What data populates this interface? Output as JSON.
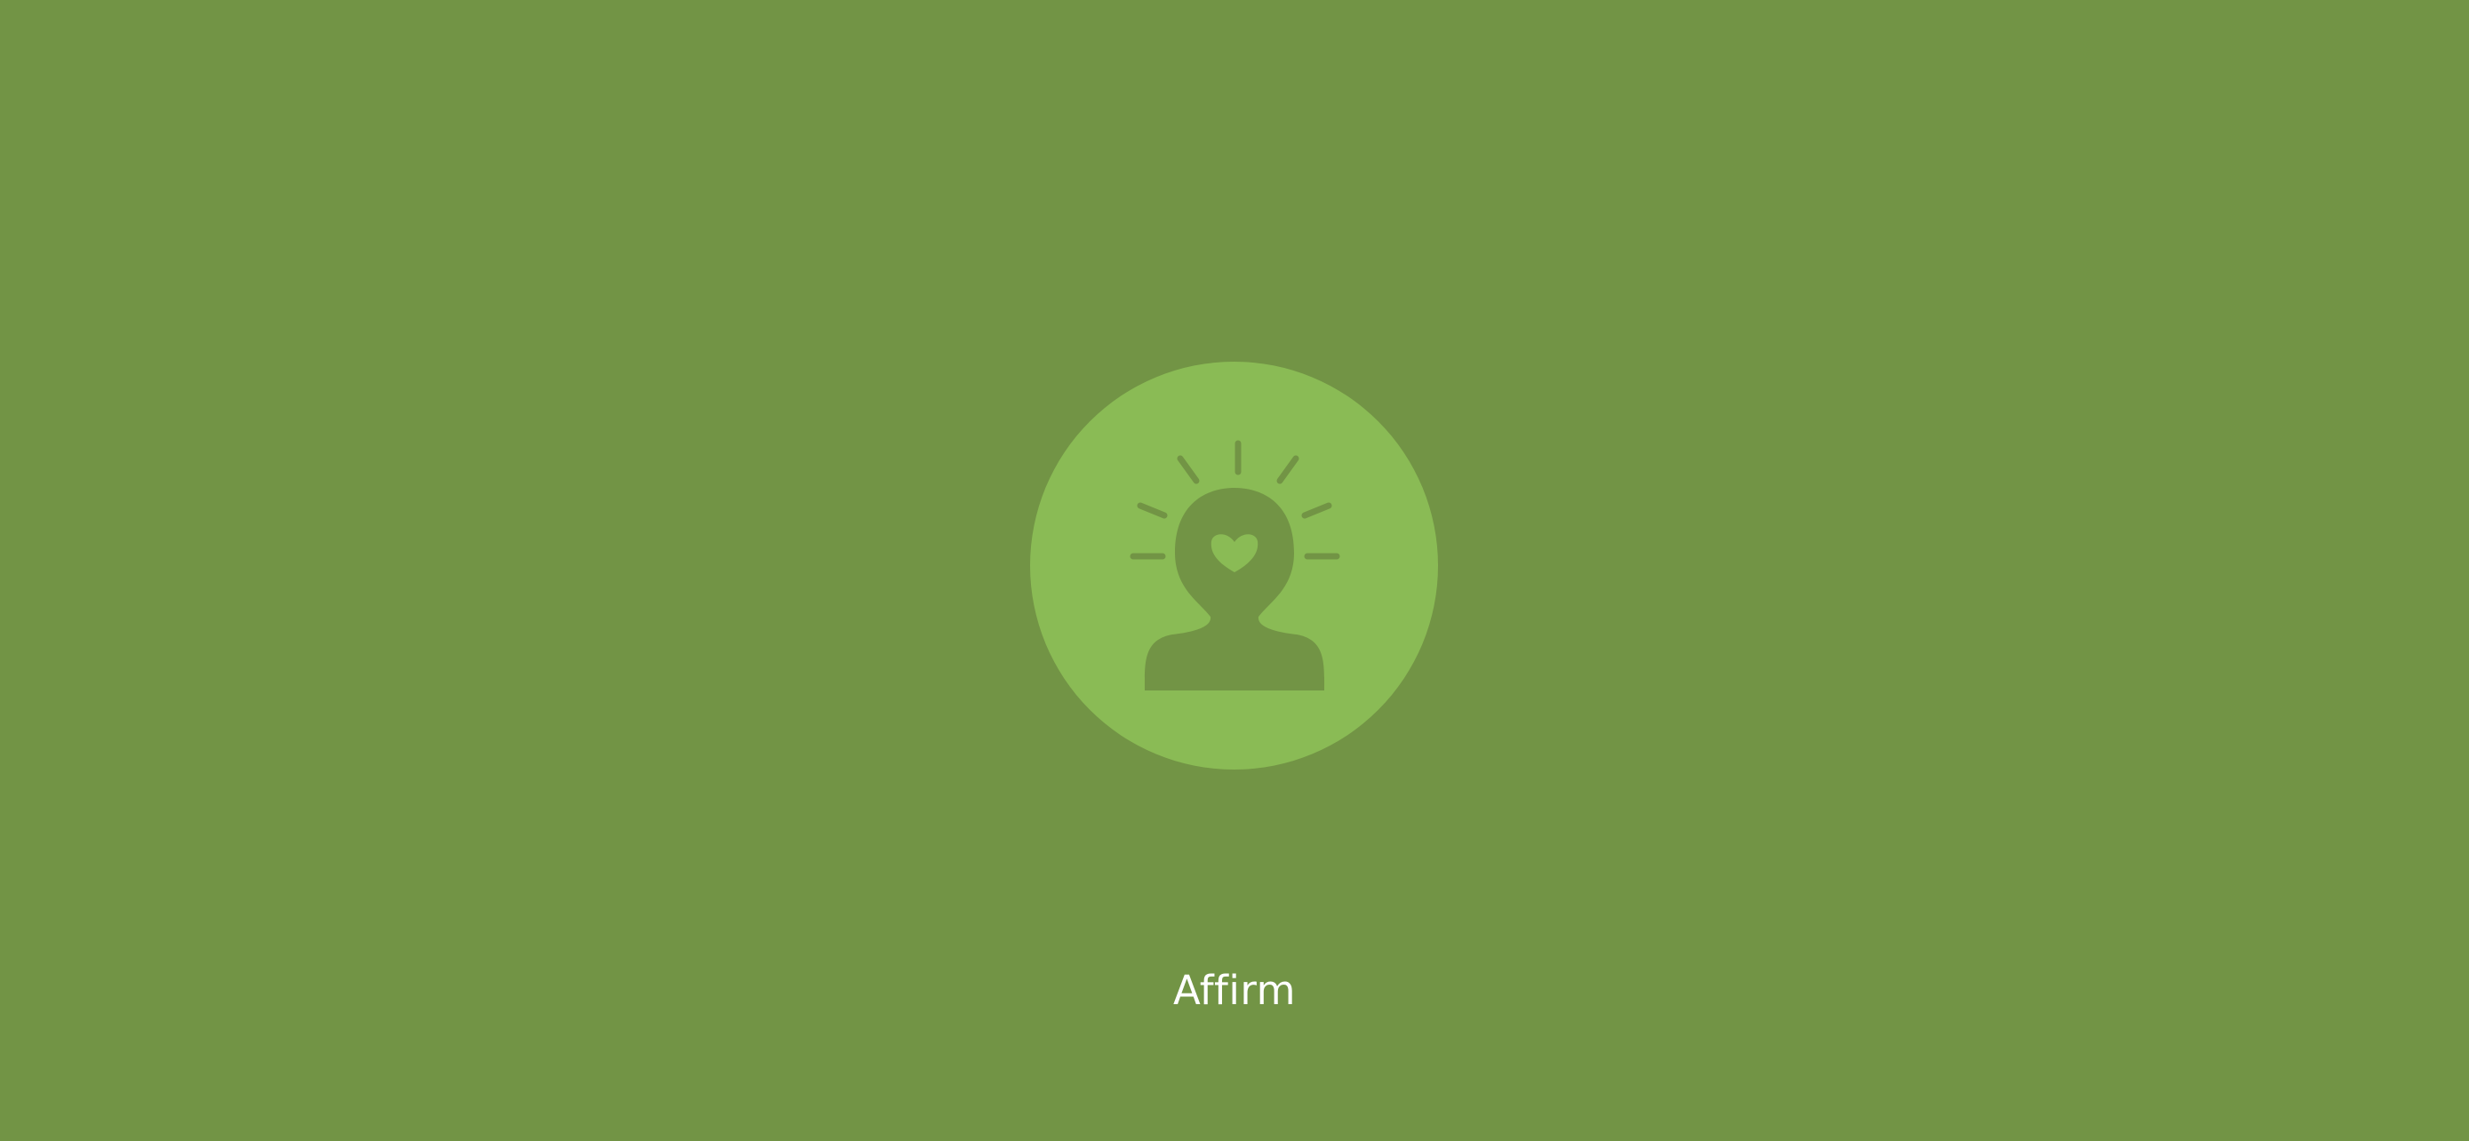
{
  "app": {
    "name": "Affirm",
    "logo_icon": "person-heart-glow-icon"
  },
  "colors": {
    "background": "#729445",
    "logo_circle": "#8abb55",
    "logo_figure": "#729445",
    "text": "#ffffff"
  }
}
